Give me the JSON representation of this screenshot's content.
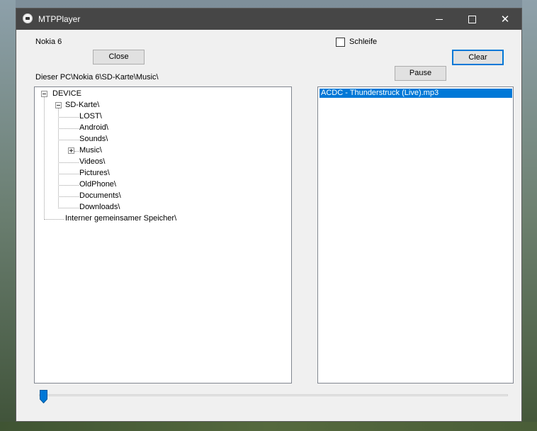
{
  "window": {
    "title": "MTPPlayer"
  },
  "device_label": "Nokia 6",
  "buttons": {
    "close": "Close",
    "clear": "Clear",
    "pause": "Pause"
  },
  "loop": {
    "label": "Schleife",
    "checked": false
  },
  "path": "Dieser PC\\Nokia 6\\SD-Karte\\Music\\",
  "tree": {
    "root": "DEVICE",
    "sd_card": "SD-Karte\\",
    "folders": [
      "LOST\\",
      "Android\\",
      "Sounds\\",
      "Music\\",
      "Videos\\",
      "Pictures\\",
      "OldPhone\\",
      "Documents\\",
      "Downloads\\"
    ],
    "internal": "Interner gemeinsamer Speicher\\"
  },
  "playlist": [
    "ACDC - Thunderstruck (Live).mp3"
  ],
  "playback": {
    "position": 0.0
  },
  "colors": {
    "selection": "#0078d7",
    "titlebar": "#464646"
  }
}
